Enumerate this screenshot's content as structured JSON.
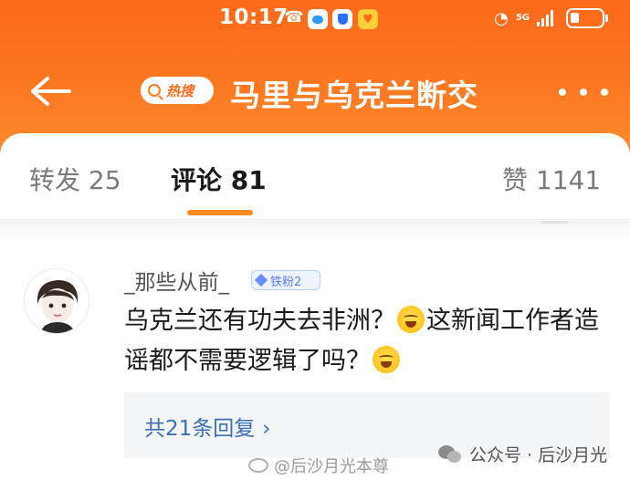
{
  "status_bar": {
    "time": "10:17",
    "network_label": "5G",
    "icons": [
      "missed-call-icon",
      "message-icon",
      "shield-icon",
      "heart-icon",
      "wifi-icon",
      "signal-icon",
      "battery-icon"
    ]
  },
  "header": {
    "hot_search_label": "热搜",
    "topic_title": "马里与乌克兰断交",
    "icons": [
      "back-arrow-icon",
      "search-icon",
      "more-icon"
    ]
  },
  "tabs": [
    {
      "label": "转发 25"
    },
    {
      "label": "评论 81"
    },
    {
      "label": "赞 1141"
    }
  ],
  "active_tab": "评论 81",
  "comment": {
    "username": "_那些从前_",
    "fan_badge": "铁粉2",
    "text_part1": "乌克兰还有功夫去非洲？",
    "text_part2": "这新闻工作者造谣都不需要逻辑了吗？",
    "reply_link": "共21条回复",
    "reply_chevron": "›"
  },
  "watermarks": {
    "weibo": "@后沙月光本尊",
    "wechat": "公众号 · 后沙月光"
  },
  "colors": {
    "header_orange": "#fc7420",
    "tab_underline": "#ff8a1f",
    "reply_link": "#3a6fb5"
  }
}
